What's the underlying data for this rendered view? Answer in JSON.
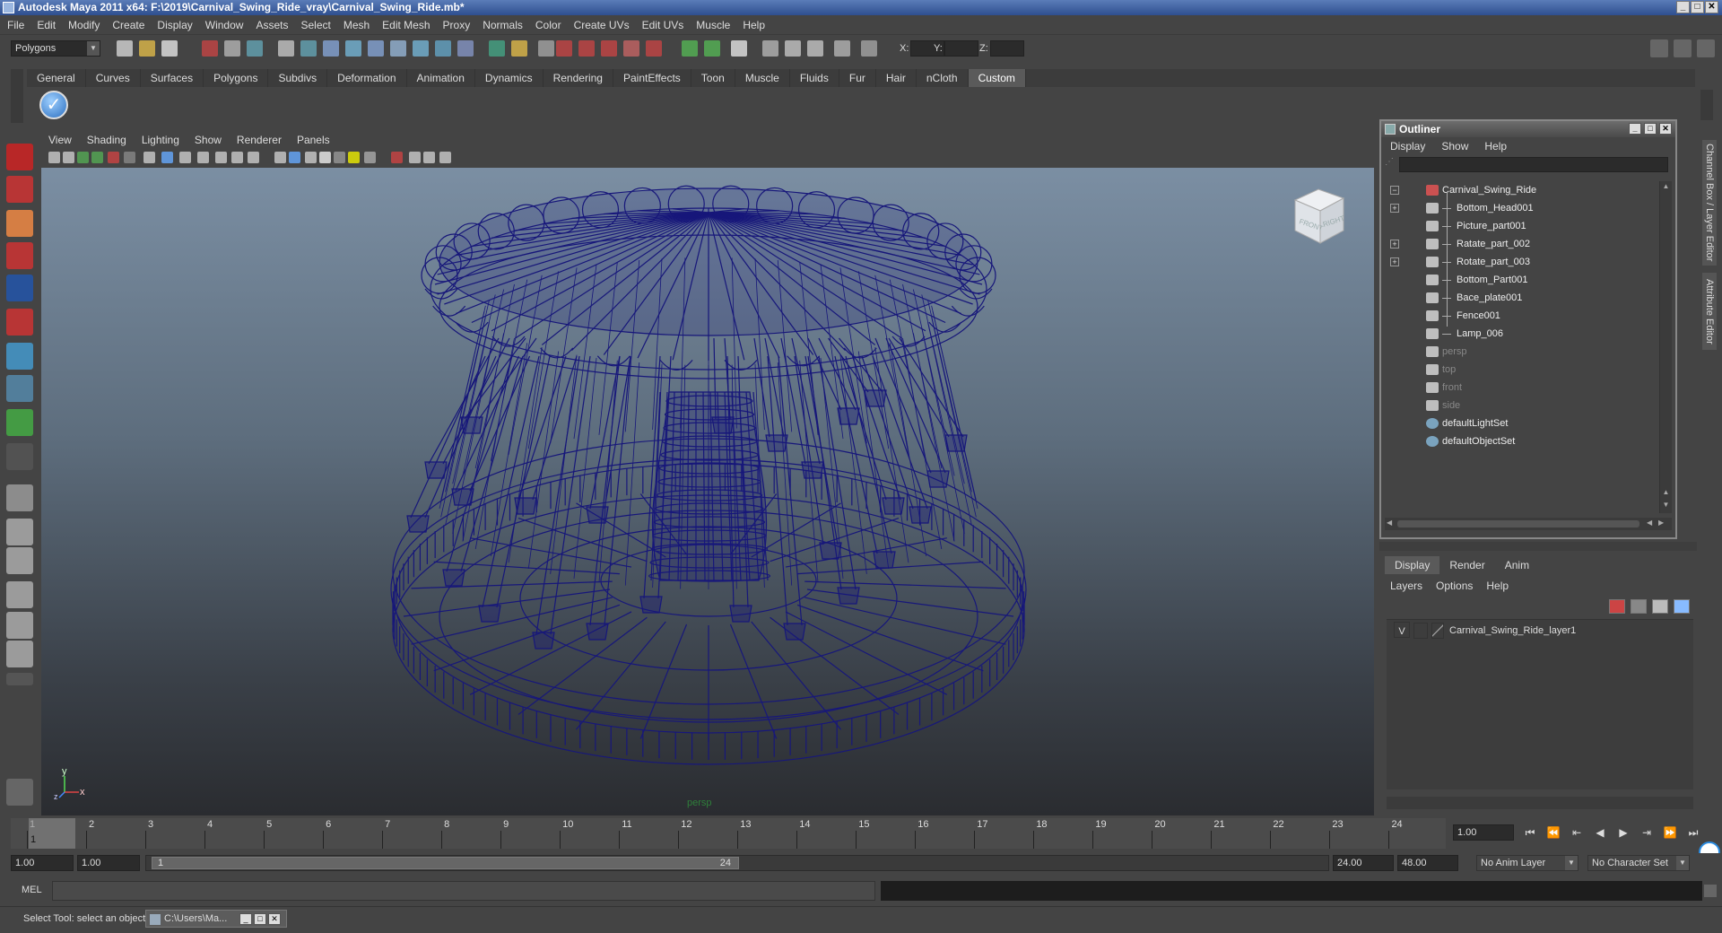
{
  "window": {
    "title": "Autodesk Maya 2011 x64: F:\\2019\\Carnival_Swing_Ride_vray\\Carnival_Swing_Ride.mb*",
    "min": "_",
    "max": "□",
    "close": "✕"
  },
  "menubar": [
    "File",
    "Edit",
    "Modify",
    "Create",
    "Display",
    "Window",
    "Assets",
    "Select",
    "Mesh",
    "Edit Mesh",
    "Proxy",
    "Normals",
    "Color",
    "Create UVs",
    "Edit UVs",
    "Muscle",
    "Help"
  ],
  "statusline": {
    "mode": "Polygons",
    "x_label": "X:",
    "y_label": "Y:",
    "z_label": "Z:"
  },
  "shelf_tabs": [
    "General",
    "Curves",
    "Surfaces",
    "Polygons",
    "Subdivs",
    "Deformation",
    "Animation",
    "Dynamics",
    "Rendering",
    "PaintEffects",
    "Toon",
    "Muscle",
    "Fluids",
    "Fur",
    "Hair",
    "nCloth",
    "Custom"
  ],
  "shelf_active": "Custom",
  "viewport": {
    "menu": [
      "View",
      "Shading",
      "Lighting",
      "Show",
      "Renderer",
      "Panels"
    ],
    "camera_label": "persp",
    "viewcube": {
      "front": "FRONT",
      "right": "RIGHT"
    },
    "axis": {
      "y": "y",
      "x": "x",
      "z": "z"
    },
    "wire_color": "#17177a"
  },
  "outliner": {
    "title": "Outliner",
    "menu": [
      "Display",
      "Show",
      "Help"
    ],
    "items": [
      {
        "label": "Carnival_Swing_Ride",
        "indent": 0,
        "expander": "−",
        "dim": false,
        "icon": "group"
      },
      {
        "label": "Bottom_Head001",
        "indent": 1,
        "expander": "+",
        "dim": false,
        "icon": "mesh"
      },
      {
        "label": "Picture_part001",
        "indent": 1,
        "expander": "",
        "dim": false,
        "icon": "mesh"
      },
      {
        "label": "Ratate_part_002",
        "indent": 1,
        "expander": "+",
        "dim": false,
        "icon": "mesh"
      },
      {
        "label": "Rotate_part_003",
        "indent": 1,
        "expander": "+",
        "dim": false,
        "icon": "mesh"
      },
      {
        "label": "Bottom_Part001",
        "indent": 1,
        "expander": "",
        "dim": false,
        "icon": "mesh"
      },
      {
        "label": "Bace_plate001",
        "indent": 1,
        "expander": "",
        "dim": false,
        "icon": "mesh"
      },
      {
        "label": "Fence001",
        "indent": 1,
        "expander": "",
        "dim": false,
        "icon": "mesh"
      },
      {
        "label": "Lamp_006",
        "indent": 1,
        "expander": "",
        "dim": false,
        "icon": "mesh"
      },
      {
        "label": "persp",
        "indent": 0,
        "expander": "",
        "dim": true,
        "icon": "camera"
      },
      {
        "label": "top",
        "indent": 0,
        "expander": "",
        "dim": true,
        "icon": "camera"
      },
      {
        "label": "front",
        "indent": 0,
        "expander": "",
        "dim": true,
        "icon": "camera"
      },
      {
        "label": "side",
        "indent": 0,
        "expander": "",
        "dim": true,
        "icon": "camera"
      },
      {
        "label": "defaultLightSet",
        "indent": 0,
        "expander": "",
        "dim": false,
        "icon": "set"
      },
      {
        "label": "defaultObjectSet",
        "indent": 0,
        "expander": "",
        "dim": false,
        "icon": "set"
      }
    ]
  },
  "layer_editor": {
    "tabs": [
      "Display",
      "Render",
      "Anim"
    ],
    "active_tab": "Display",
    "menu": [
      "Layers",
      "Options",
      "Help"
    ],
    "layers": [
      {
        "visible": "V",
        "name": "Carnival_Swing_Ride_layer1"
      }
    ]
  },
  "side_tabs": [
    "Channel Box / Layer Editor",
    "Attribute Editor"
  ],
  "timeline": {
    "ticks": [
      "1",
      "2",
      "3",
      "4",
      "5",
      "6",
      "7",
      "8",
      "9",
      "10",
      "11",
      "12",
      "13",
      "14",
      "15",
      "16",
      "17",
      "18",
      "19",
      "20",
      "21",
      "22",
      "23",
      "24"
    ],
    "current_frame": "1",
    "current_field": "1.00"
  },
  "range": {
    "start": "1.00",
    "playback_start": "1.00",
    "slider_start": "1",
    "slider_end": "24",
    "playback_end": "24.00",
    "end": "48.00",
    "anim_layer": "No Anim Layer",
    "character_set": "No Character Set"
  },
  "playback": [
    "⏮",
    "⏪",
    "⇤",
    "◀",
    "▶",
    "⇥",
    "⏩",
    "⏭"
  ],
  "cmdline": {
    "label": "MEL"
  },
  "helpline": {
    "text": "Select Tool: select an object",
    "task": "C:\\Users\\Ma..."
  }
}
